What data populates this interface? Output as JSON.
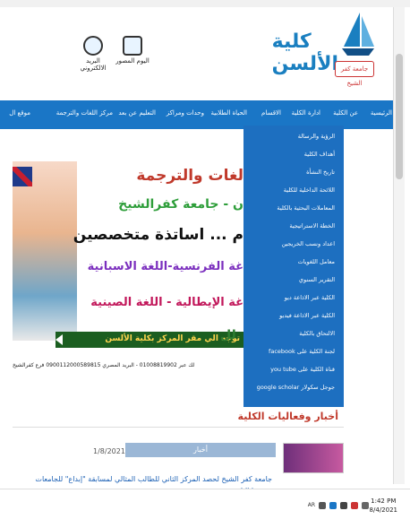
{
  "header": {
    "logo_text": "كلية الألسن",
    "logo_badge": "جامعة كفر الشيخ",
    "links": [
      {
        "label": "اليوم المصور",
        "icon": "gallery-icon"
      },
      {
        "label": "البريد الالكتروني",
        "icon": "email-icon"
      }
    ]
  },
  "nav": {
    "items": [
      "الرئيسية",
      "عن الكلية",
      "ادارة الكلية",
      "الاقسام",
      "الحياة الطلابية",
      "وحدات ومراكز",
      "التعليم عن بعد",
      "مركز اللغات والترجمة",
      "موقع ال"
    ]
  },
  "dropdown": {
    "items": [
      "الرؤية والرسالة",
      "أهداف الكلية",
      "تاريخ النشأة",
      "اللائحة الداخلية للكلية",
      "المعاملات البحثية بالكلية",
      "الخطة الاستراتيجية",
      "اعداد ونسب الخريجين",
      "معامل اللغويات",
      "التقرير السنوي",
      "الكلية عبر الاذاعة ديو",
      "الكلية عبر الاذاعة فيديو",
      "الالتحاق بالكلية",
      "facebook لجنة الكلية على",
      "you tube قناة الكلية على",
      "google scholar جوجل سكولار"
    ]
  },
  "banner": {
    "line1": "لغات والترجمة",
    "line2": "ن - جامعة كفرالشيخ",
    "line3": "م ... اساتذة متخصصين",
    "line4": "غة الفرنسية-اللغة الاسبانية",
    "line5": "غة الإيطالية - اللغة الصينية",
    "strip": "توجه الي مقر المركز بكلية الألسن",
    "strip_prefix": "لل"
  },
  "info_line": "لك عبر 01008819902 - البريد المصري 0900112000589815 فرع كفرالشيخ",
  "section": {
    "title": "أخبار وفعاليات الكلية"
  },
  "news": {
    "tag": "أخبار",
    "date": "1/8/2021",
    "title": "جامعة كفر الشيخ لحصد المركز الثاني للطالب المثالي لمسابقة \"إبداع\" للجامعات نسختها التاسعة"
  },
  "taskbar": {
    "time": "1:42 PM",
    "date": "8/4/2021",
    "lang": "AR"
  },
  "colors": {
    "nav": "#1a76c6",
    "dropdown": "#1d6fc0",
    "accent_red": "#c0392b",
    "banner_green": "#1b5e20"
  }
}
